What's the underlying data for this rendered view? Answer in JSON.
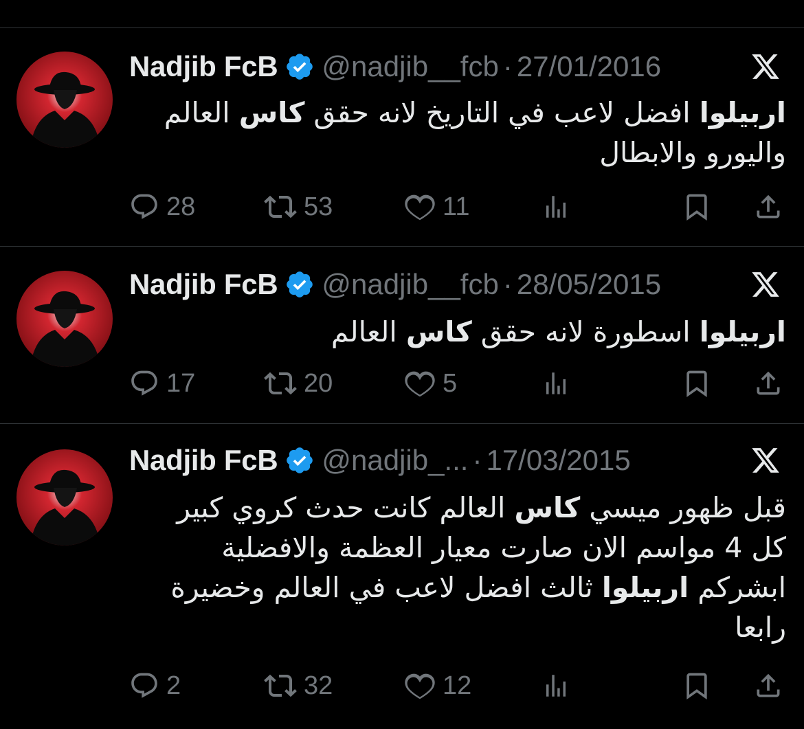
{
  "colors": {
    "background": "#000000",
    "divider": "#2f3336",
    "text": "#e7e9ea",
    "muted": "#71767b",
    "verified": "#1d9bf0",
    "avatar_red": "#d22630"
  },
  "tweets": [
    {
      "display_name": "Nadjib FcB",
      "handle": "@nadjib__fcb",
      "separator": "·",
      "date": "27/01/2016",
      "text_lines": [
        [
          {
            "t": "اربيلوا",
            "b": true
          },
          {
            "t": " افضل لاعب في التاريخ لانه حقق ",
            "b": false
          },
          {
            "t": "كاس",
            "b": true
          },
          {
            "t": " العالم",
            "b": false
          }
        ],
        [
          {
            "t": "واليورو والابطال",
            "b": false
          }
        ]
      ],
      "replies": "28",
      "retweets": "53",
      "likes": "11"
    },
    {
      "display_name": "Nadjib FcB",
      "handle": "@nadjib__fcb",
      "separator": "·",
      "date": "28/05/2015",
      "text_lines": [
        [
          {
            "t": "اربيلوا",
            "b": true
          },
          {
            "t": " اسطورة لانه حقق ",
            "b": false
          },
          {
            "t": "كاس",
            "b": true
          },
          {
            "t": " العالم",
            "b": false
          }
        ]
      ],
      "replies": "17",
      "retweets": "20",
      "likes": "5"
    },
    {
      "display_name": "Nadjib FcB",
      "handle": "@nadjib_...",
      "separator": "·",
      "date": "17/03/2015",
      "text_lines": [
        [
          {
            "t": "قبل ظهور ميسي ",
            "b": false
          },
          {
            "t": "كاس",
            "b": true
          },
          {
            "t": " العالم كانت حدث كروي كبير",
            "b": false
          }
        ],
        [
          {
            "t": "كل 4 مواسم الان صارت معيار العظمة والافضلية",
            "b": false
          }
        ],
        [
          {
            "t": "ابشركم ",
            "b": false
          },
          {
            "t": "اربيلوا",
            "b": true
          },
          {
            "t": " ثالث افضل لاعب في العالم وخضيرة",
            "b": false
          }
        ],
        [
          {
            "t": "رابعا",
            "b": false
          }
        ]
      ],
      "replies": "2",
      "retweets": "32",
      "likes": "12"
    }
  ],
  "icons": {
    "reply": "speech-bubble-icon",
    "retweet": "retweet-arrows-icon",
    "like": "heart-icon",
    "views": "bar-chart-icon",
    "bookmark": "bookmark-icon",
    "share": "share-upload-icon",
    "platform": "x-logo-icon",
    "verified": "verified-badge-icon"
  }
}
